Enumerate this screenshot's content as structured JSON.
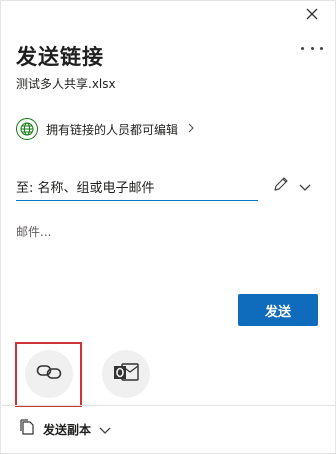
{
  "dialog": {
    "title": "发送链接",
    "file_name": "测试多人共享.xlsx",
    "permission_text": "拥有链接的人员都可编辑",
    "to_placeholder": "至: 名称、组或电子邮件",
    "message_placeholder": "邮件...",
    "send_label": "发送",
    "send_copy_label": "发送副本"
  },
  "icons": {
    "close": "close-icon",
    "more": "more-options-icon",
    "permission": "globe-icon",
    "pencil": "pencil-icon",
    "dropdown": "chevron-down-icon",
    "copy_link": "link-icon",
    "outlook": "outlook-icon",
    "send_copy": "copy-document-icon"
  },
  "colors": {
    "accent": "#0f6cbd",
    "highlight_border": "#d13438",
    "permission_green": "#107c10"
  }
}
